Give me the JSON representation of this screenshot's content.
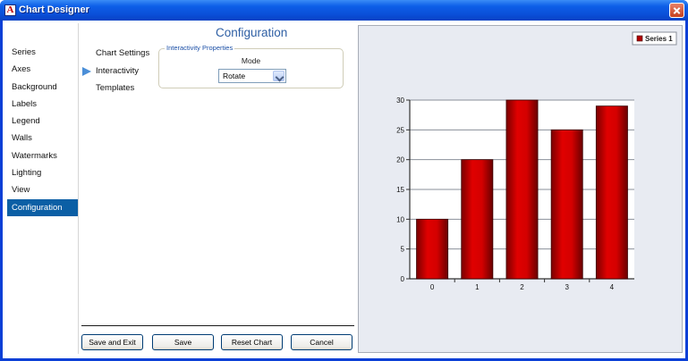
{
  "window": {
    "title": "Chart Designer",
    "icon": "app-logo-icon"
  },
  "nav": {
    "items": [
      {
        "label": "Series",
        "selected": false
      },
      {
        "label": "Axes",
        "selected": false
      },
      {
        "label": "Background",
        "selected": false
      },
      {
        "label": "Labels",
        "selected": false
      },
      {
        "label": "Legend",
        "selected": false
      },
      {
        "label": "Walls",
        "selected": false
      },
      {
        "label": "Watermarks",
        "selected": false
      },
      {
        "label": "Lighting",
        "selected": false
      },
      {
        "label": "View",
        "selected": false
      },
      {
        "label": "Configuration",
        "selected": true
      }
    ]
  },
  "page": {
    "title": "Configuration"
  },
  "sub_nav": {
    "items": [
      {
        "label": "Chart Settings",
        "selected": false
      },
      {
        "label": "Interactivity",
        "selected": true
      },
      {
        "label": "Templates",
        "selected": false
      }
    ]
  },
  "interactivity": {
    "group_label": "Interactivity Properties",
    "mode_label": "Mode",
    "mode_value": "Rotate"
  },
  "buttons": {
    "save_exit": "Save and Exit",
    "save": "Save",
    "reset": "Reset Chart",
    "cancel": "Cancel"
  },
  "colors": {
    "titlebar": "#0a4fd8",
    "selected_nav": "#0b5fa5",
    "page_title": "#2e5fa4",
    "bar_fill": "#cc0000",
    "preview_bg": "#e8ebf2"
  },
  "chart_data": {
    "type": "bar",
    "categories": [
      "0",
      "1",
      "2",
      "3",
      "4"
    ],
    "series": [
      {
        "name": "Series 1",
        "values": [
          10,
          20,
          30,
          25,
          29
        ]
      }
    ],
    "ylim": [
      0,
      30
    ],
    "yticks": [
      0,
      5,
      10,
      15,
      20,
      25,
      30
    ],
    "grid": true,
    "legend": "top-right",
    "title": "",
    "xlabel": "",
    "ylabel": ""
  }
}
